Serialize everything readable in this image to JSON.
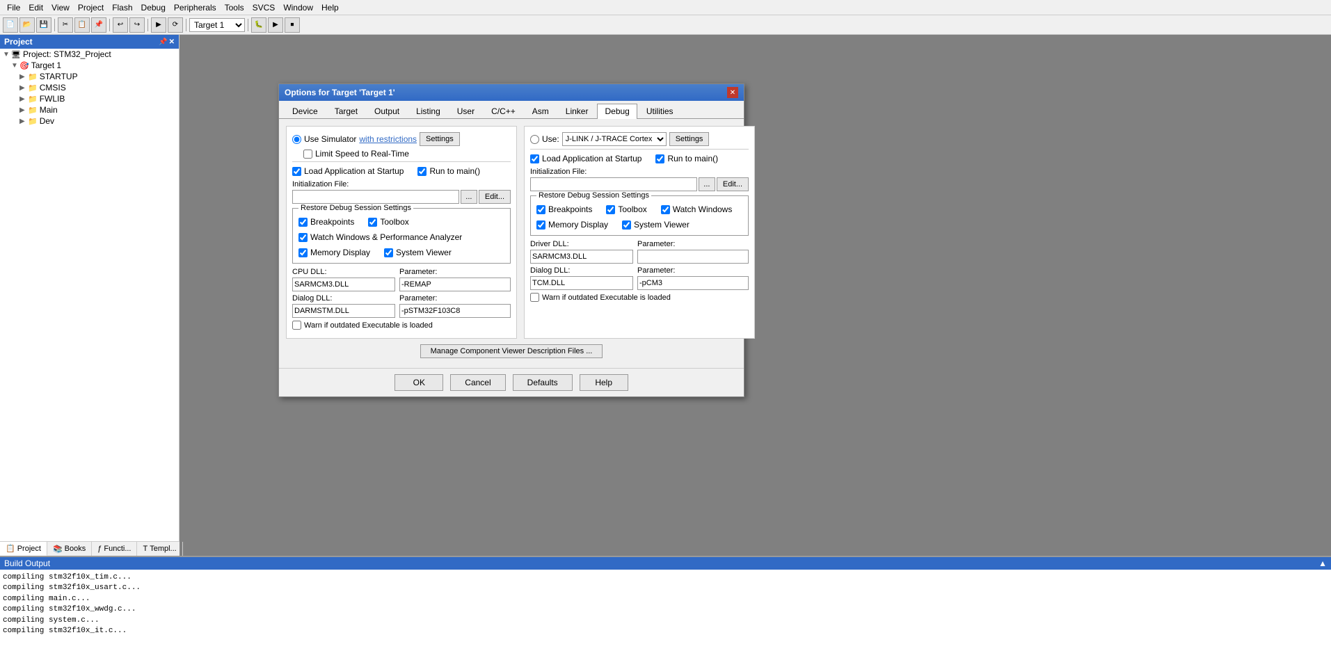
{
  "menubar": {
    "items": [
      "File",
      "Edit",
      "View",
      "Project",
      "Flash",
      "Debug",
      "Peripherals",
      "Tools",
      "SVCS",
      "Window",
      "Help"
    ]
  },
  "toolbar": {
    "target_select": "Target 1"
  },
  "sidebar": {
    "title": "Project",
    "project_name": "Project: STM32_Project",
    "tree": [
      {
        "label": "Project: STM32_Project",
        "level": 0,
        "expand": "▼",
        "icon": "📁"
      },
      {
        "label": "Target 1",
        "level": 1,
        "expand": "▼",
        "icon": "🎯"
      },
      {
        "label": "STARTUP",
        "level": 2,
        "expand": "▶",
        "icon": "📂"
      },
      {
        "label": "CMSIS",
        "level": 2,
        "expand": "▶",
        "icon": "📂"
      },
      {
        "label": "FWLIB",
        "level": 2,
        "expand": "▶",
        "icon": "📂"
      },
      {
        "label": "Main",
        "level": 2,
        "expand": "▶",
        "icon": "📂"
      },
      {
        "label": "Dev",
        "level": 2,
        "expand": "▶",
        "icon": "📂"
      }
    ],
    "tabs": [
      {
        "label": "Project",
        "icon": "📋",
        "active": true
      },
      {
        "label": "Books",
        "icon": "📚",
        "active": false
      },
      {
        "label": "Functi...",
        "icon": "ƒ",
        "active": false
      },
      {
        "label": "Templ...",
        "icon": "T",
        "active": false
      }
    ]
  },
  "build_output": {
    "title": "Build Output",
    "lines": [
      "compiling stm32f10x_tim.c...",
      "compiling stm32f10x_usart.c...",
      "compiling main.c...",
      "compiling stm32f10x_wwdg.c...",
      "compiling system.c...",
      "compiling stm32f10x_it.c..."
    ]
  },
  "dialog": {
    "title": "Options for Target 'Target 1'",
    "tabs": [
      "Device",
      "Target",
      "Output",
      "Listing",
      "User",
      "C/C++",
      "Asm",
      "Linker",
      "Debug",
      "Utilities"
    ],
    "active_tab": "Debug",
    "left_col": {
      "use_simulator": true,
      "use_simulator_label": "Use Simulator",
      "with_restrictions_label": "with restrictions",
      "settings_label": "Settings",
      "limit_speed": false,
      "limit_speed_label": "Limit Speed to Real-Time",
      "load_app_startup": true,
      "load_app_label": "Load Application at Startup",
      "run_to_main": true,
      "run_to_main_label": "Run to main()",
      "init_file_label": "Initialization File:",
      "init_file_value": "",
      "restore_group_label": "Restore Debug Session Settings",
      "breakpoints": true,
      "breakpoints_label": "Breakpoints",
      "toolbox": true,
      "toolbox_label": "Toolbox",
      "watch_windows": true,
      "watch_windows_label": "Watch Windows & Performance Analyzer",
      "memory_display": true,
      "memory_display_label": "Memory Display",
      "system_viewer": true,
      "system_viewer_label": "System Viewer",
      "cpu_dll_label": "CPU DLL:",
      "cpu_dll_value": "SARMCM3.DLL",
      "cpu_param_label": "Parameter:",
      "cpu_param_value": "-REMAP",
      "dialog_dll_label": "Dialog DLL:",
      "dialog_dll_value": "DARMSTM.DLL",
      "dialog_param_label": "Parameter:",
      "dialog_param_value": "-pSTM32F103C8",
      "warn_outdated": false,
      "warn_outdated_label": "Warn if outdated Executable is loaded"
    },
    "right_col": {
      "use_radio": false,
      "use_label": "Use:",
      "use_select_value": "J-LINK / J-TRACE Cortex",
      "settings_label": "Settings",
      "load_app_startup": true,
      "load_app_label": "Load Application at Startup",
      "run_to_main": true,
      "run_to_main_label": "Run to main()",
      "init_file_label": "Initialization File:",
      "init_file_value": "",
      "restore_group_label": "Restore Debug Session Settings",
      "breakpoints": true,
      "breakpoints_label": "Breakpoints",
      "toolbox": true,
      "toolbox_label": "Toolbox",
      "watch_windows": true,
      "watch_windows_label": "Watch Windows",
      "memory_display": true,
      "memory_display_label": "Memory Display",
      "system_viewer": true,
      "system_viewer_label": "System Viewer",
      "driver_dll_label": "Driver DLL:",
      "driver_dll_value": "SARMCM3.DLL",
      "driver_param_label": "Parameter:",
      "driver_param_value": "",
      "dialog_dll_label": "Dialog DLL:",
      "dialog_dll_value": "TCM.DLL",
      "dialog_param_label": "Parameter:",
      "dialog_param_value": "-pCM3",
      "warn_outdated": false,
      "warn_outdated_label": "Warn if outdated Executable is loaded"
    },
    "manage_btn_label": "Manage Component Viewer Description Files ...",
    "footer": {
      "ok": "OK",
      "cancel": "Cancel",
      "defaults": "Defaults",
      "help": "Help"
    }
  }
}
